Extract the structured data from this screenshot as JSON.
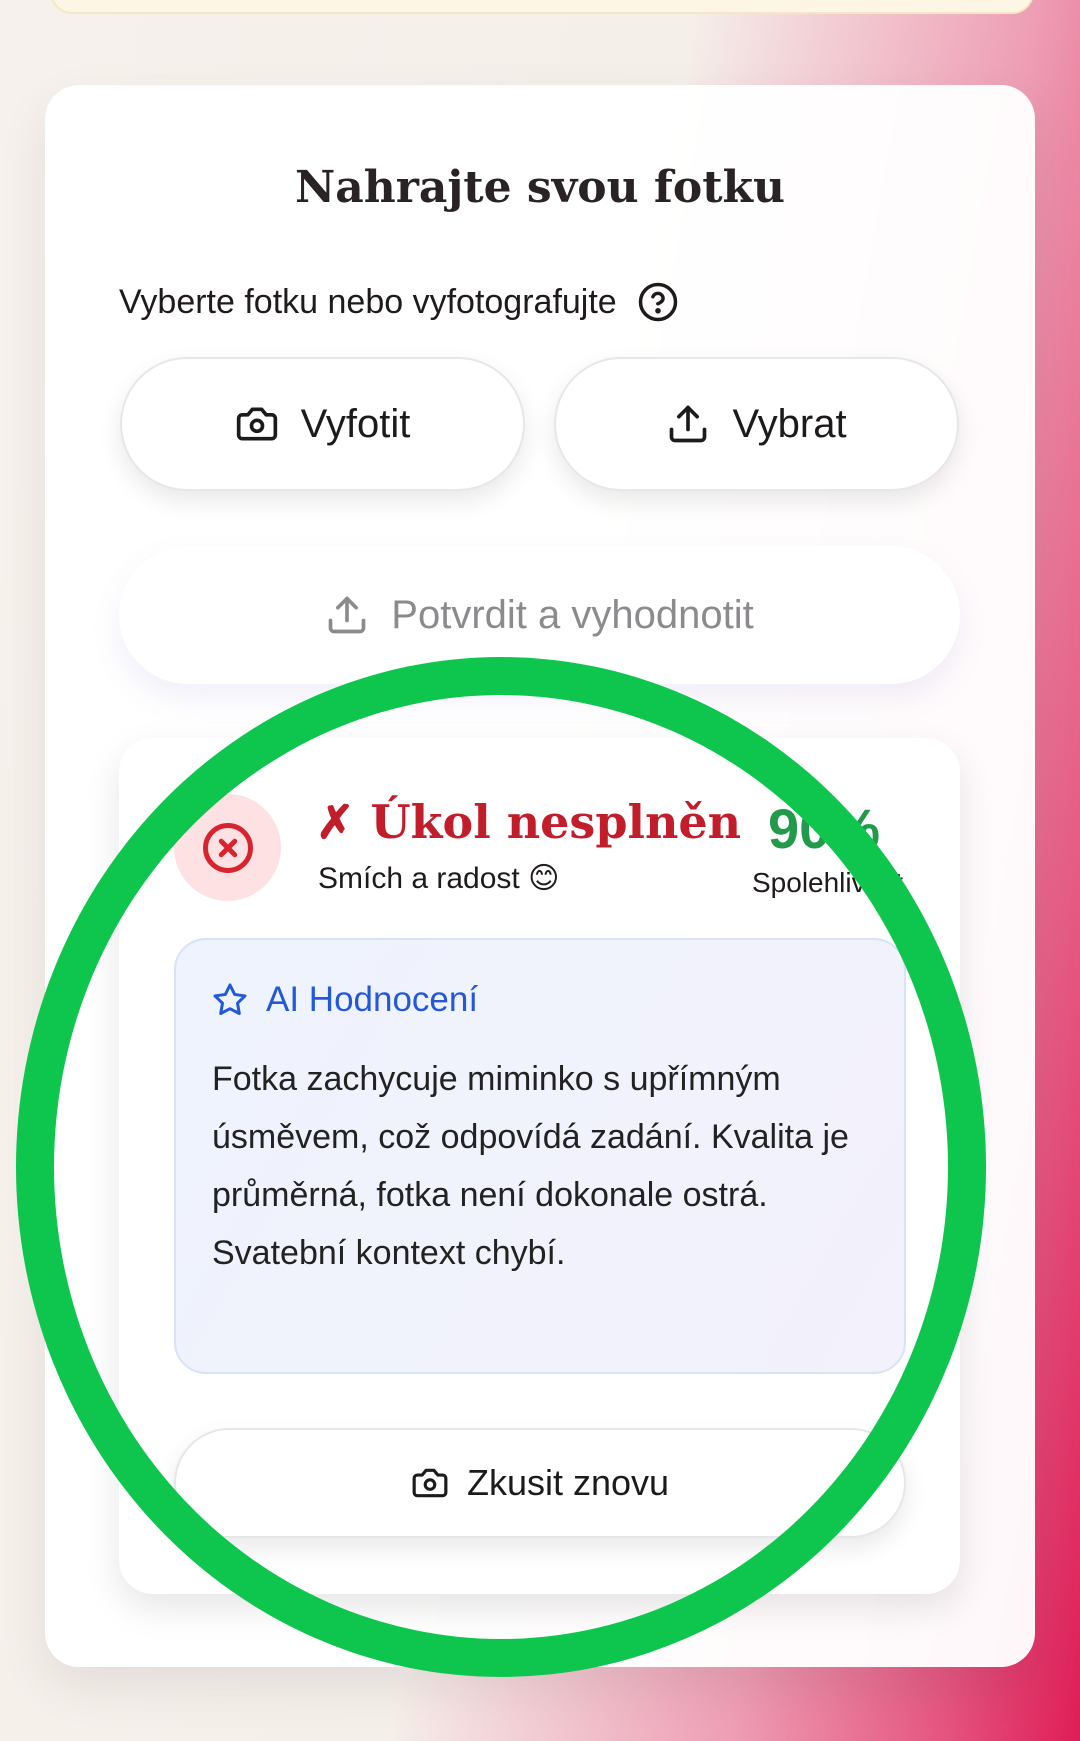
{
  "upload": {
    "title": "Nahrajte svou fotku",
    "instruction": "Vyberte fotku nebo vyfotografujte",
    "take_photo_label": "Vyfotit",
    "choose_label": "Vybrat",
    "confirm_label": "Potvrdit a vyhodnotit"
  },
  "result": {
    "status_title": "✗ Úkol nesplněn",
    "task_name": "Smích a radost 😊",
    "score": "90%",
    "score_label": "Spolehlivost",
    "ai_title": "AI Hodnocení",
    "ai_text": "Fotka zachycuje miminko s upřímným úsměvem, což odpovídá zadání. Kvalita je průměrná, fotka není dokonale ostrá. Svatební kontext chybí.",
    "retry_label": "Zkusit znovu"
  },
  "colors": {
    "error": "#c21d2b",
    "score": "#239a4b",
    "ai_accent": "#2358d6",
    "annotation_ring": "#0ec54e"
  },
  "icons": [
    "help-circle-icon",
    "camera-icon",
    "upload-icon",
    "x-circle-icon",
    "star-icon"
  ]
}
